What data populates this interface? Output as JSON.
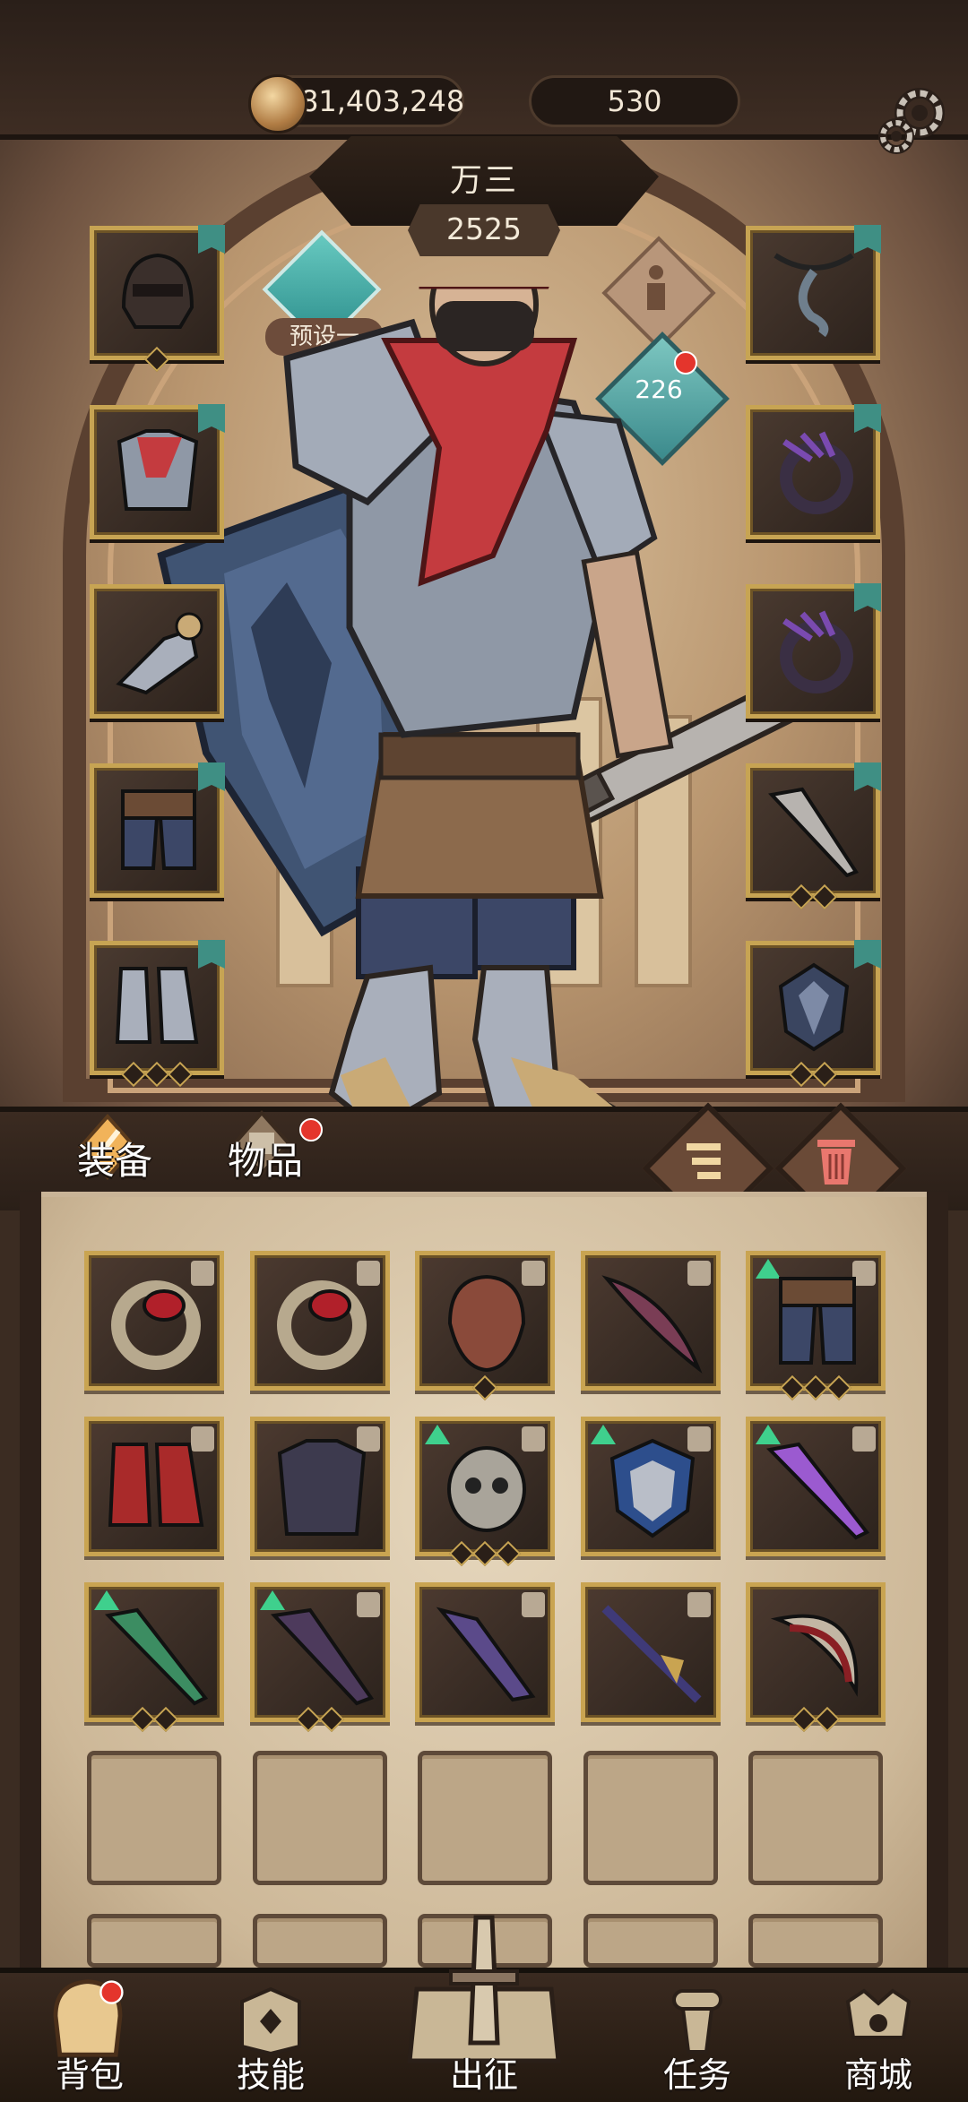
{
  "currency": {
    "gold": "81,403,248",
    "gems": "530"
  },
  "hero": {
    "name": "万三",
    "power": "2525",
    "level": "226"
  },
  "preset": {
    "label": "预设一"
  },
  "equip_slots": {
    "left": [
      "helmet-icon",
      "chest-armor-icon",
      "gauntlet-icon",
      "pants-icon",
      "boots-icon"
    ],
    "right": [
      "necklace-icon",
      "ring-icon",
      "ring-icon",
      "sword-icon",
      "shield-icon"
    ]
  },
  "tabs": {
    "equipment": "装备",
    "items": "物品"
  },
  "bag_items": [
    [
      "ring-icon",
      "ring-icon",
      "mask-icon",
      "blade-icon",
      "pants-icon"
    ],
    [
      "boots-icon",
      "armor-icon",
      "skull-helm-icon",
      "shield-icon",
      "sword-icon"
    ],
    [
      "sword-icon",
      "blade-icon",
      "dagger-icon",
      "spear-icon",
      "scythe-icon"
    ]
  ],
  "bottom_nav": [
    {
      "label": "背包",
      "icon": "backpack-icon"
    },
    {
      "label": "技能",
      "icon": "skill-book-icon"
    },
    {
      "label": "出征",
      "icon": "expedition-sword-icon"
    },
    {
      "label": "任务",
      "icon": "scroll-icon"
    },
    {
      "label": "商城",
      "icon": "shop-icon"
    }
  ],
  "colors": {
    "gold_frame": "#c7a453",
    "teal": "#3f8f84",
    "upgrade": "#3fd08d",
    "alert": "#e4352c"
  }
}
